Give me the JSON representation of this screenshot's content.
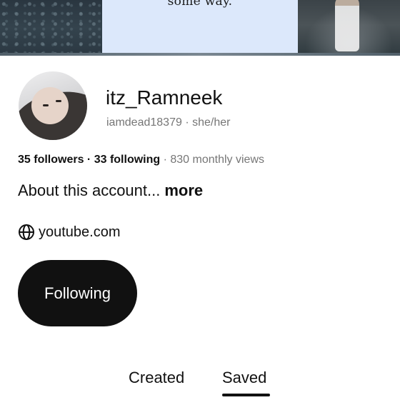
{
  "cover": {
    "quote_fragment": "some way."
  },
  "profile": {
    "display_name": "itz_Ramneek",
    "username": "iamdead18379",
    "separator": " · ",
    "pronouns": "she/her"
  },
  "stats": {
    "followers": "35 followers",
    "dot": " · ",
    "following": "33 following",
    "monthly_views": " · 830 monthly views"
  },
  "about": {
    "text": "About this account...",
    "more": "more"
  },
  "website": {
    "icon": "globe-icon",
    "text": "youtube.com"
  },
  "actions": {
    "following_label": "Following"
  },
  "tabs": [
    {
      "label": "Created",
      "active": false
    },
    {
      "label": "Saved",
      "active": true
    }
  ],
  "colors": {
    "primary_text": "#111111",
    "secondary_text": "#767676",
    "button_bg": "#111111",
    "button_text": "#ffffff",
    "cover_card": "#dce8fb"
  }
}
